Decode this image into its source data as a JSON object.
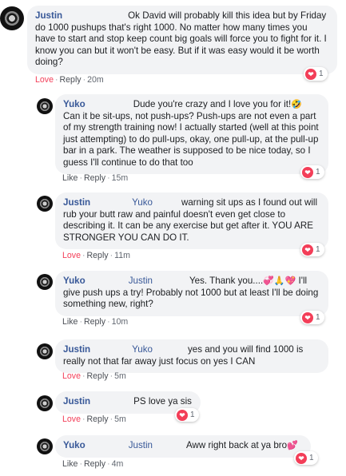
{
  "comments": [
    {
      "author": "Justin",
      "text": "Ok David will probably kill this idea but by Friday do 1000 pushups that's right 1000. No matter how many times you have to start and stop keep count big goals will force you to fight for it. I know you can but it won't be easy. But if it was easy would it be worth doing?",
      "love": "Love",
      "reply": "Reply",
      "time": "20m",
      "reactions": "1"
    },
    {
      "author": "Yuko",
      "text_a": "Dude you're crazy and I love you for it!",
      "emoji_a": "🤣",
      "text_b": "Can it be sit-ups, not push-ups? Push-ups are not even a part of my strength training now! I actually started (well at this point just attempting) to do pull-ups, okay, one pull-up, at the pull-up bar in a park. The weather is supposed to be nice today, so I guess I'll continue to do that too",
      "like": "Like",
      "reply": "Reply",
      "time": "15m",
      "reactions": "1"
    },
    {
      "author": "Justin",
      "mention": "Yuko",
      "text": "warning sit ups as I found out will rub your butt raw and painful doesn't even get close to describing it. It can be any exercise but get after it. YOU ARE STRONGER YOU CAN DO IT.",
      "love": "Love",
      "reply": "Reply",
      "time": "11m",
      "reactions": "1"
    },
    {
      "author": "Yuko",
      "mention": "Justin",
      "text_a": "Yes. Thank you....",
      "emojis": "💞🙏💖",
      "text_b": "I'll give push ups a try! Probably not 1000 but at least I'll be doing something new, right?",
      "like": "Like",
      "reply": "Reply",
      "time": "10m",
      "reactions": "1"
    },
    {
      "author": "Justin",
      "mention": "Yuko",
      "text": "yes and you will find 1000 is really not that far away just focus on yes I CAN",
      "love": "Love",
      "reply": "Reply",
      "time": "5m"
    },
    {
      "author": "Justin",
      "text": "PS love ya sis",
      "love": "Love",
      "reply": "Reply",
      "time": "5m",
      "reactions": "1"
    },
    {
      "author": "Yuko",
      "mention": "Justin",
      "text": "Aww right back at ya bro",
      "emoji": "💕",
      "like": "Like",
      "reply": "Reply",
      "time": "4m",
      "reactions": "1"
    }
  ],
  "ui": {
    "separator": "·",
    "heart_glyph": "❤"
  }
}
